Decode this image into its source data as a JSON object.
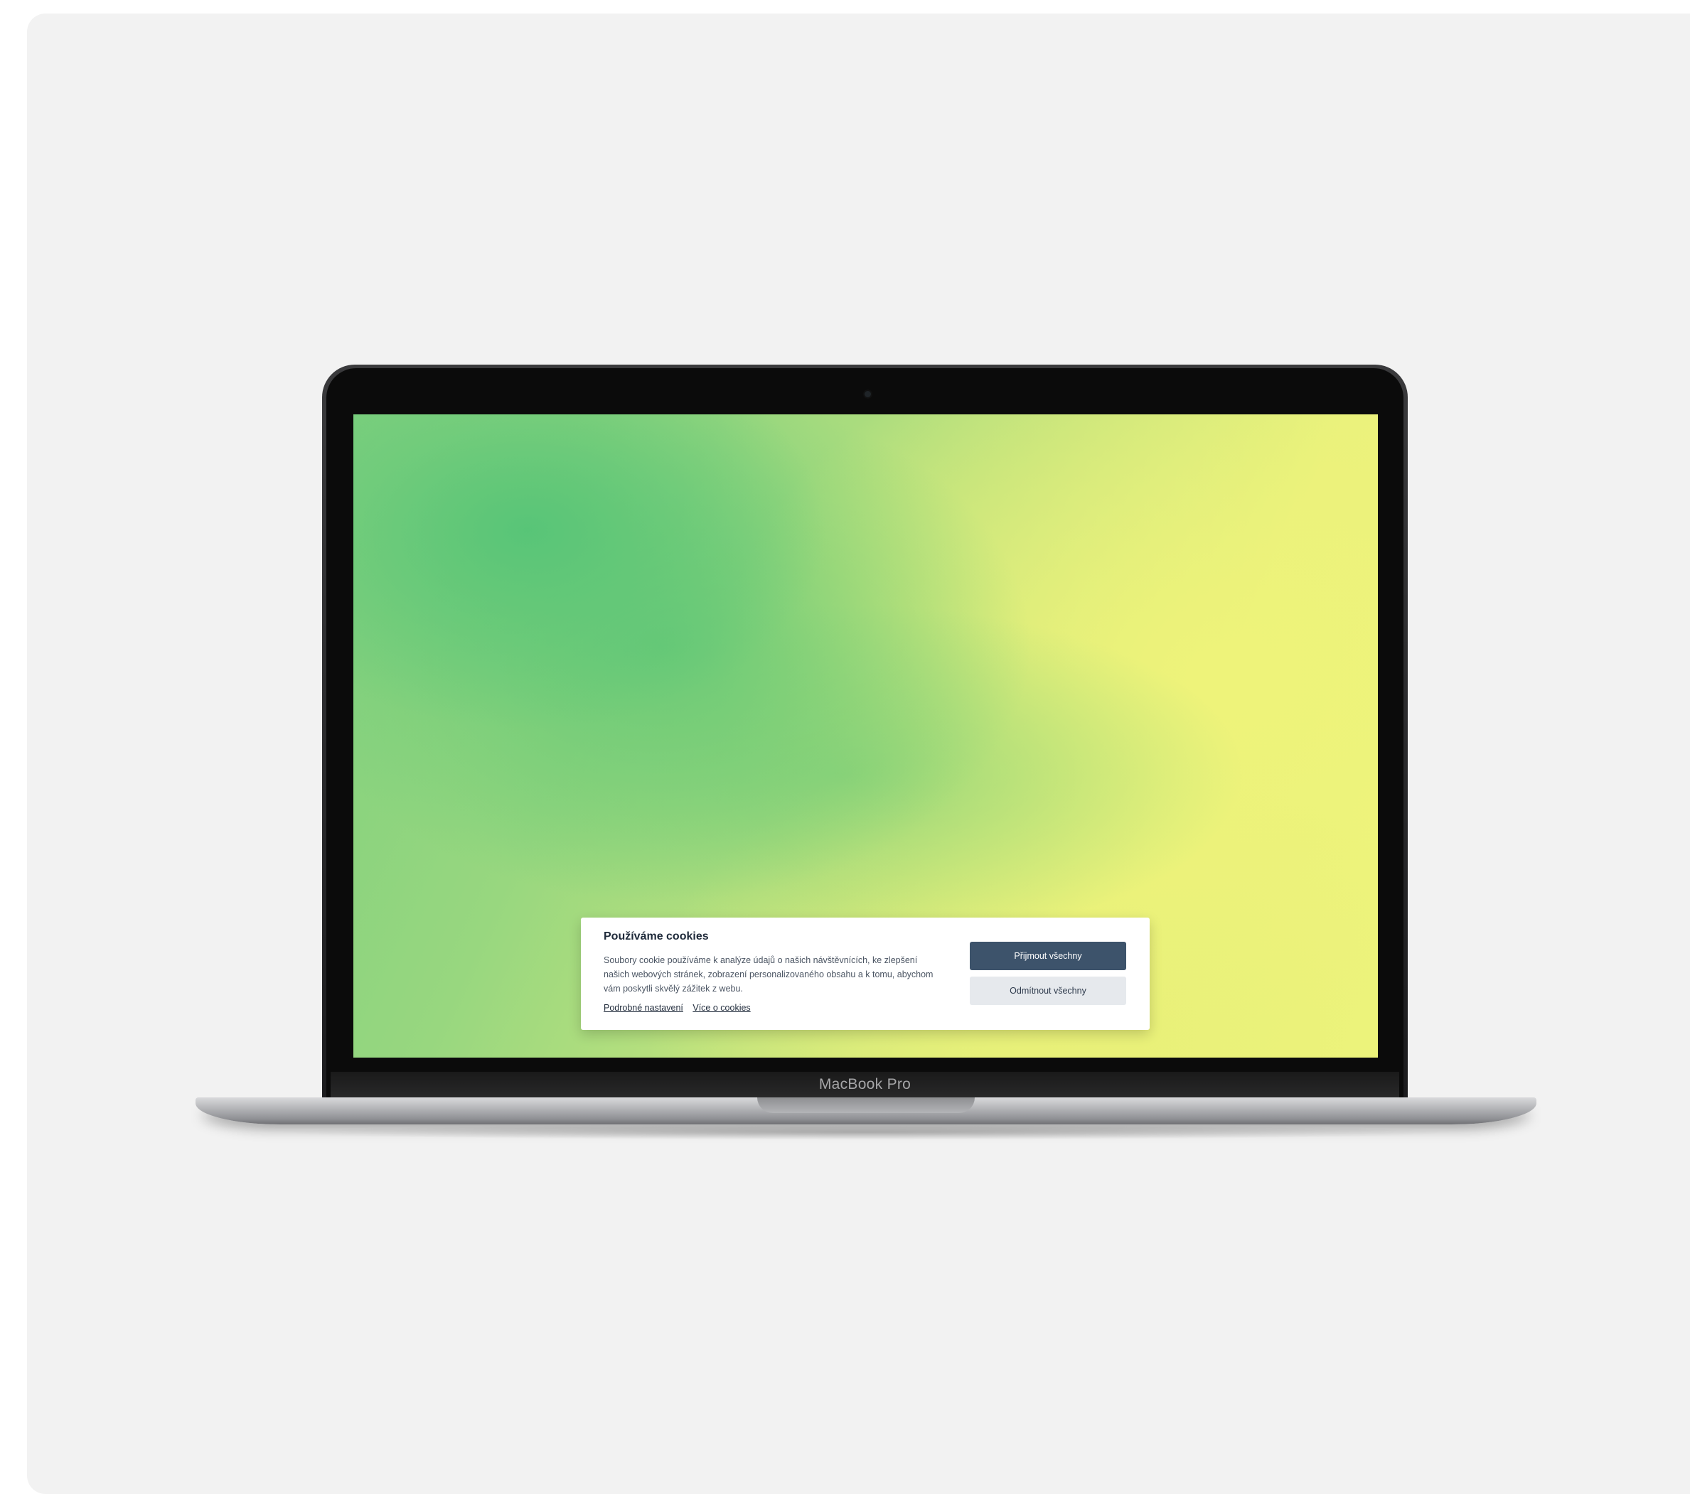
{
  "device": {
    "label": "MacBook Pro"
  },
  "cookie_banner": {
    "title": "Používáme cookies",
    "text": "Soubory cookie používáme k analýze údajů o našich návštěvnících, ke zlepšení našich webových stránek, zobrazení personalizovaného obsahu a k tomu, abychom vám poskytli skvělý zážitek z webu.",
    "link_settings": "Podrobné nastavení",
    "link_more": "Více o cookies",
    "accept_label": "Přijmout všechny",
    "reject_label": "Odmítnout všechny"
  },
  "colors": {
    "accent": "#3d536b",
    "secondary_button": "#e6e9ed",
    "wallpaper_green": "#5cc879",
    "wallpaper_yellow": "#eef47c"
  }
}
